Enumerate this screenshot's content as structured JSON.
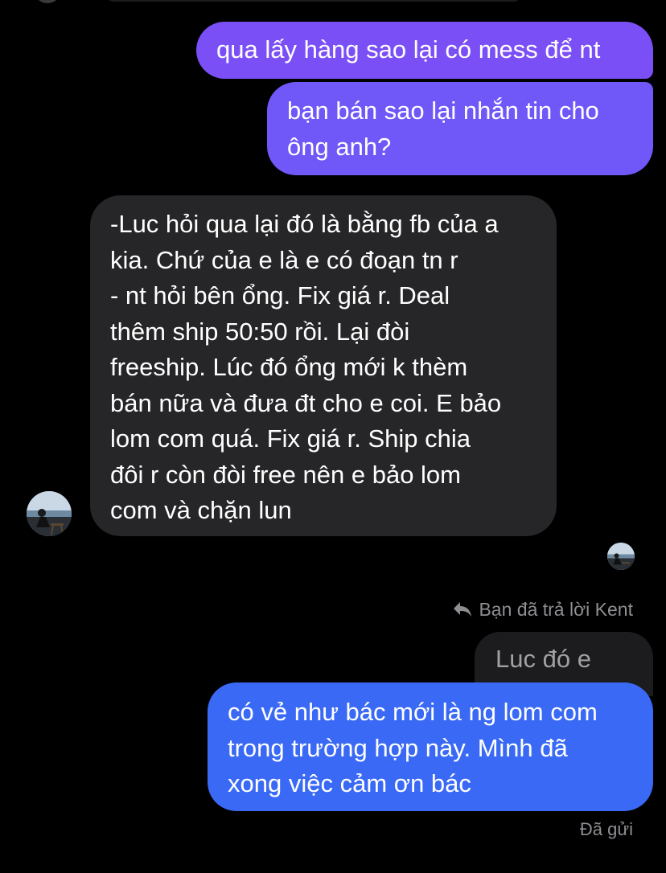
{
  "conversation": {
    "messages": [
      {
        "sender": "me",
        "text": "qua lấy hàng sao lại có mess để nt"
      },
      {
        "sender": "me",
        "text": "bạn bán sao lại nhắn tin cho\nông anh?"
      },
      {
        "sender": "other",
        "text": "-Luc hỏi qua lại đó là bằng fb của a\nkia. Chứ của e là e có đoạn tn r\n - nt hỏi bên ổng. Fix giá r. Deal\nthêm ship 50:50 rồi. Lại đòi\nfreeship. Lúc đó ổng mới k thèm\nbán nữa và đưa đt cho e coi. E bảo\nlom com quá. Fix giá r. Ship chia\nđôi r còn đòi free nên e bảo lom\ncom và chặn lun"
      },
      {
        "sender": "me",
        "text": "có vẻ như bác mới là ng lom com\ntrong trường hợp này. Mình đã\nxong việc cảm ơn bác"
      }
    ],
    "reply_note": "Bạn đã trả lời Kent",
    "reply_quote": "Luc đó e rep",
    "status": "Đã gửi"
  },
  "icons": {
    "reply": "reply-arrow-icon",
    "contact_avatar": "contact-avatar",
    "seen_avatar": "seen-receipt-avatar"
  },
  "colors": {
    "background": "#000000",
    "outgoing_top": "#7b4ff6",
    "outgoing_bottom": "#3a6af5",
    "incoming": "#262628",
    "muted_text": "#8e8e93"
  }
}
